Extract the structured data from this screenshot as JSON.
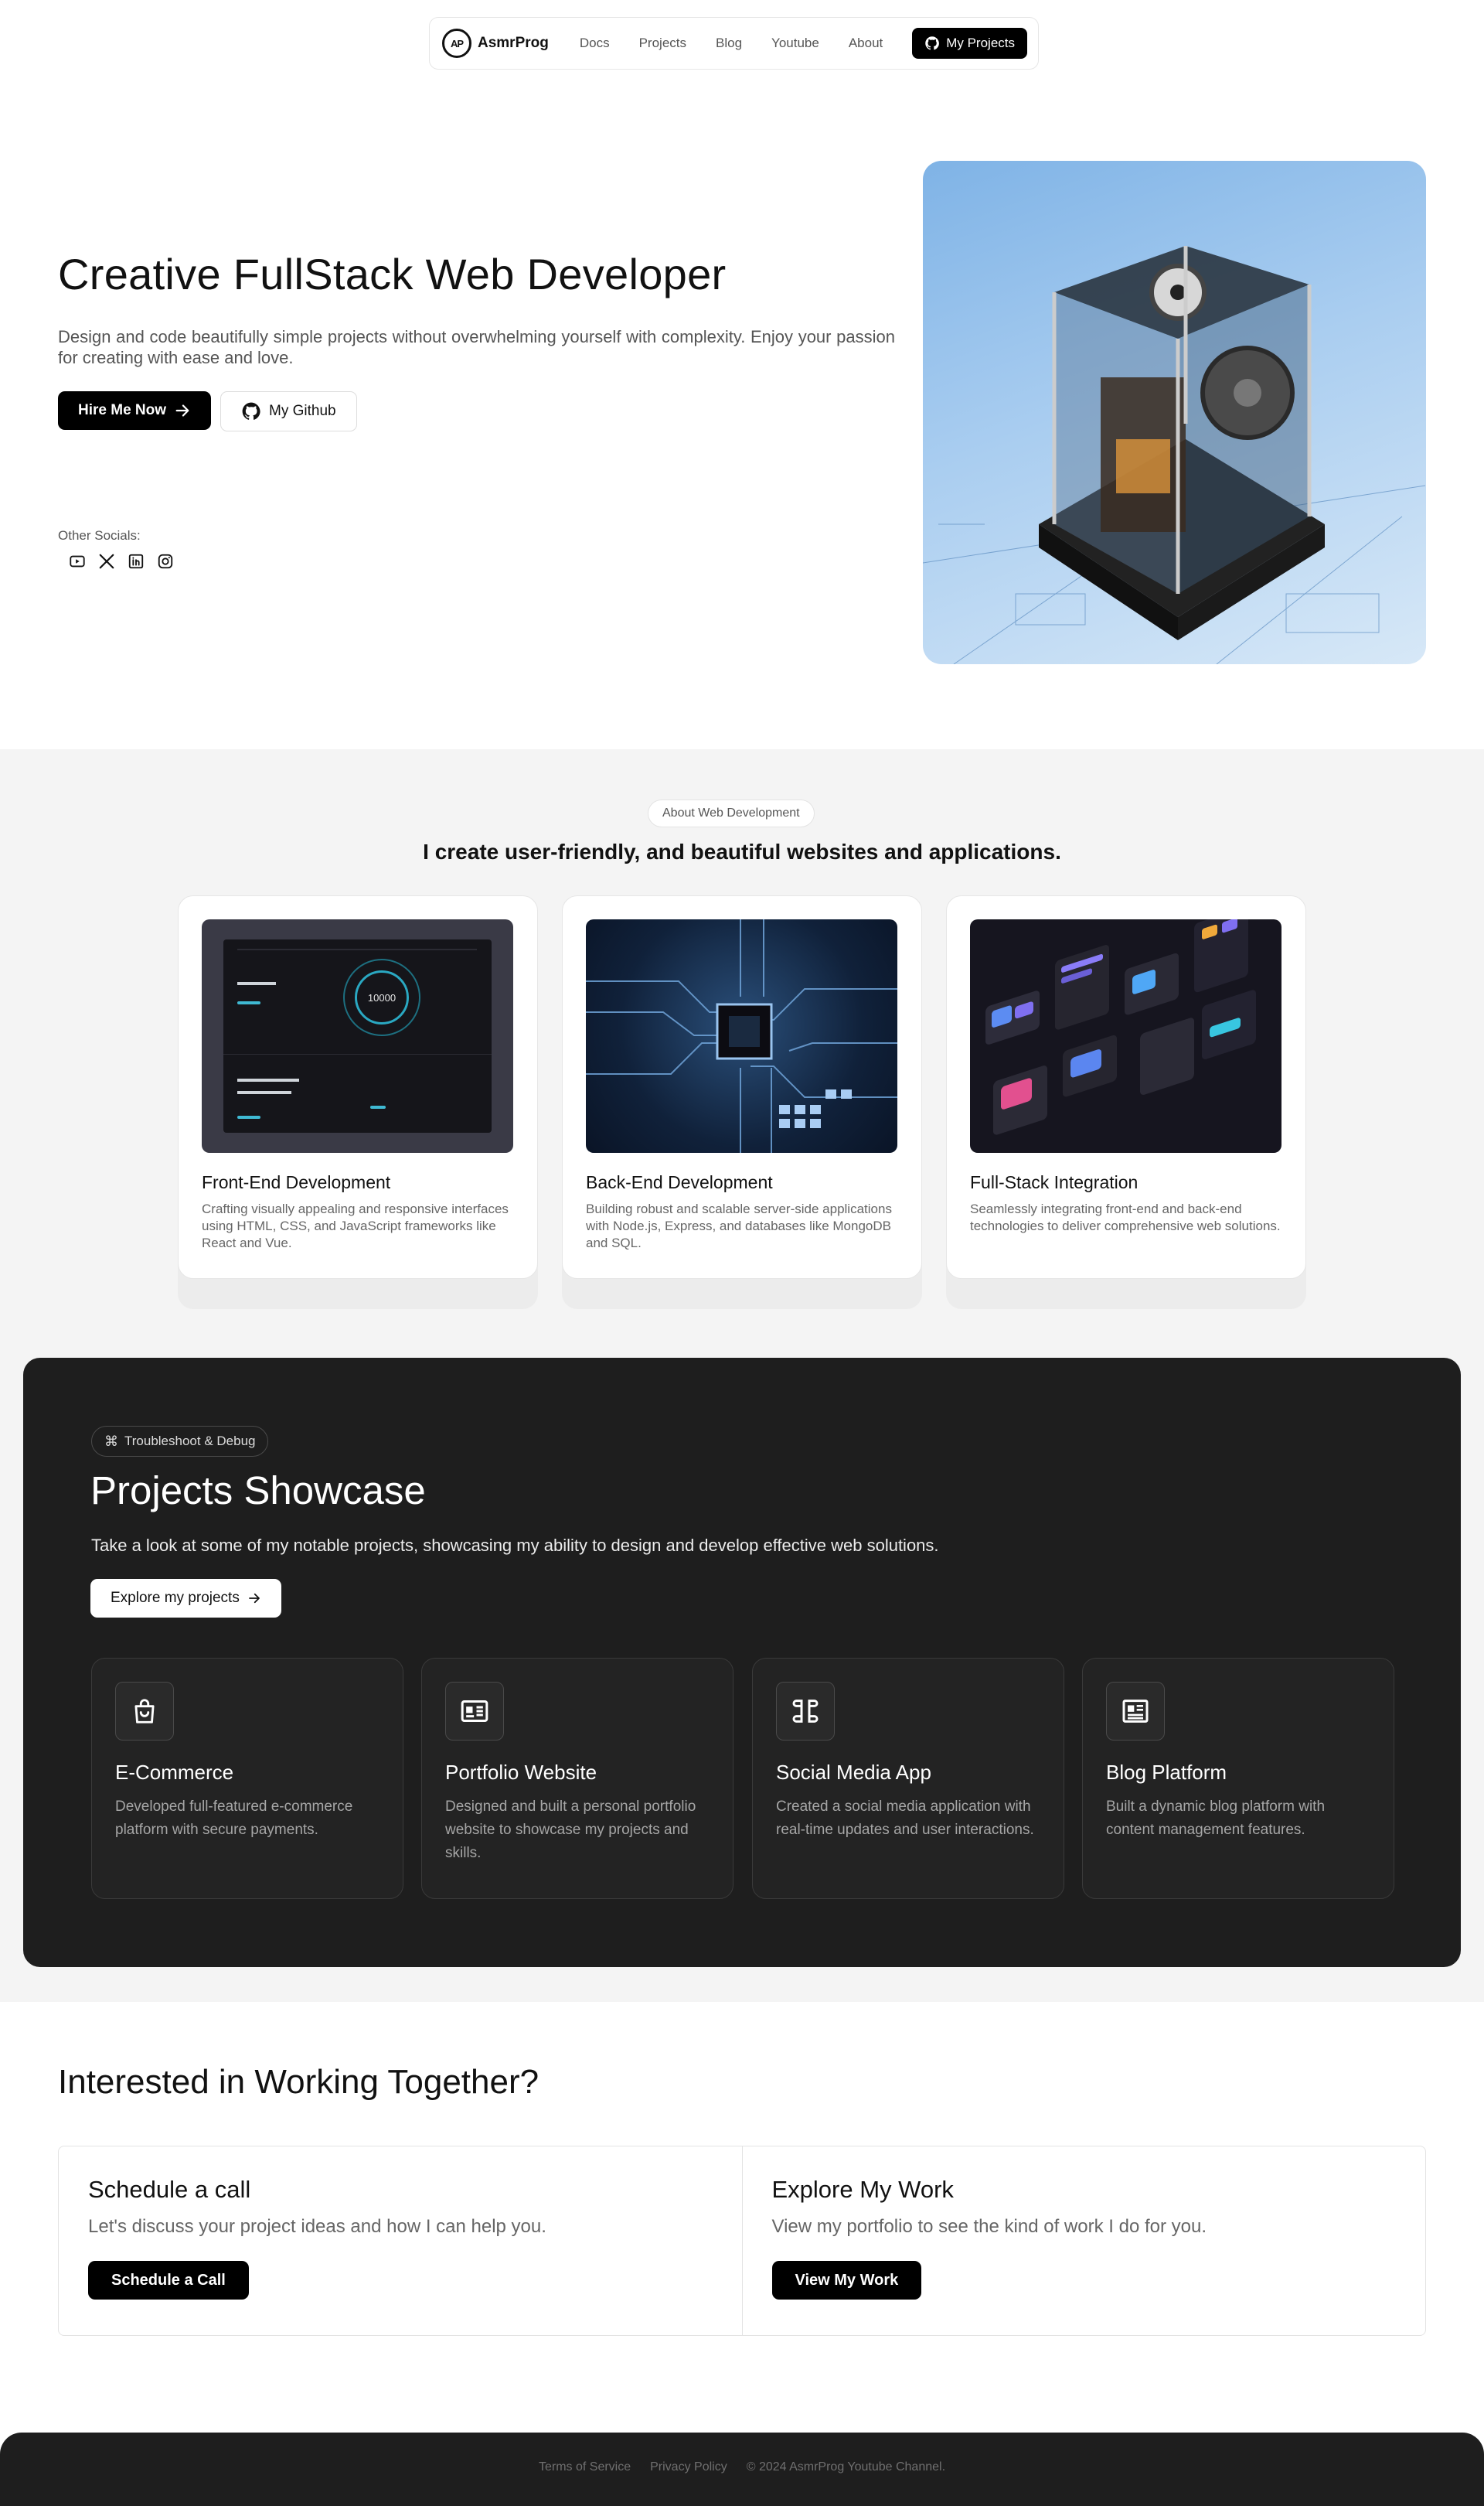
{
  "nav": {
    "brand": "AsmrProg",
    "brand_logo_text": "AP",
    "links": [
      "Docs",
      "Projects",
      "Blog",
      "Youtube",
      "About"
    ],
    "cta": "My Projects"
  },
  "hero": {
    "title": "Creative FullStack Web Developer",
    "description": "Design and code beautifully simple projects without overwhelming yourself with complexity. Enjoy your passion for creating with ease and love.",
    "primary_button": "Hire Me Now",
    "secondary_button": "My Github",
    "socials_label": "Other Socials:",
    "socials": [
      "youtube-icon",
      "x-icon",
      "linkedin-icon",
      "instagram-icon"
    ]
  },
  "about": {
    "pill": "About Web Development",
    "title": "I create user-friendly, and beautiful websites and applications.",
    "services": [
      {
        "title": "Front-End Development",
        "description": "Crafting visually appealing and responsive interfaces using HTML, CSS, and JavaScript frameworks like React and Vue.",
        "mockup_counter": "10000"
      },
      {
        "title": "Back-End Development",
        "description": "Building robust and scalable server-side applications with Node.js, Express, and databases like MongoDB and SQL."
      },
      {
        "title": "Full-Stack Integration",
        "description": "Seamlessly integrating front-end and back-end technologies to deliver comprehensive web solutions."
      }
    ]
  },
  "projects": {
    "pill": "Troubleshoot & Debug",
    "title": "Projects Showcase",
    "description": "Take a look at some of my notable projects, showcasing my ability to design and develop effective web solutions.",
    "button": "Explore my projects",
    "items": [
      {
        "title": "E-Commerce",
        "description": "Developed full-featured e-commerce platform with secure payments.",
        "icon": "shopping-bag-icon"
      },
      {
        "title": "Portfolio Website",
        "description": "Designed and built a personal portfolio website to showcase my projects and skills.",
        "icon": "id-card-icon"
      },
      {
        "title": "Social Media App",
        "description": "Created a social media application with real-time updates and user interactions.",
        "icon": "apps-icon"
      },
      {
        "title": "Blog Platform",
        "description": "Built a dynamic blog platform with content management features.",
        "icon": "newspaper-icon"
      }
    ]
  },
  "cta": {
    "title": "Interested in Working Together?",
    "schedule": {
      "title": "Schedule a call",
      "description": "Let's discuss your project ideas and how I can help you.",
      "button": "Schedule a Call"
    },
    "explore": {
      "title": "Explore My Work",
      "description": "View my portfolio to see the kind of work I do for you.",
      "button": "View My Work"
    }
  },
  "footer": {
    "terms": "Terms of Service",
    "privacy": "Privacy Policy",
    "copyright": "© 2024 AsmrProg Youtube Channel."
  },
  "colors": {
    "accent": "#000000",
    "dark_section": "#1e1e1e",
    "light_section": "#f4f4f4"
  }
}
